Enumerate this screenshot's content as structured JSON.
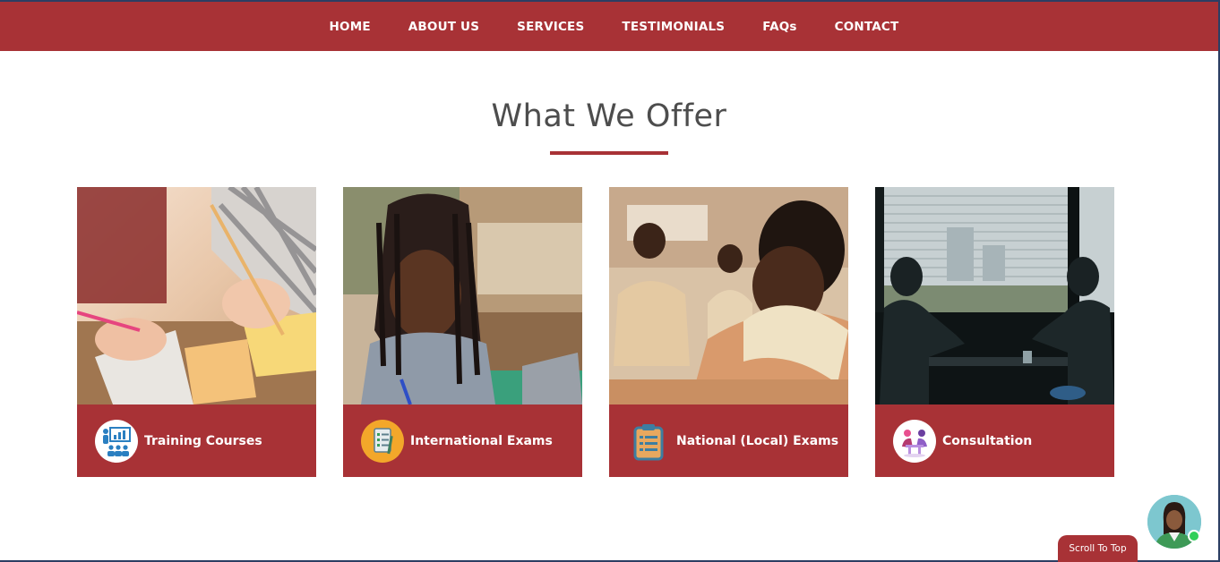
{
  "nav": {
    "items": [
      {
        "label": "HOME"
      },
      {
        "label": "ABOUT US"
      },
      {
        "label": "SERVICES"
      },
      {
        "label": "TESTIMONIALS"
      },
      {
        "label": "FAQs"
      },
      {
        "label": "CONTACT"
      }
    ]
  },
  "section": {
    "title": "What We Offer"
  },
  "cards": [
    {
      "label": "Training Courses",
      "icon": "presentation-class-icon"
    },
    {
      "label": "International Exams",
      "icon": "exam-checklist-icon"
    },
    {
      "label": "National (Local) Exams",
      "icon": "clipboard-icon"
    },
    {
      "label": "Consultation",
      "icon": "consultation-meeting-icon"
    }
  ],
  "scroll_top": {
    "label": "Scroll To Top"
  },
  "colors": {
    "brand": "#a83236",
    "title": "#4d4d4d",
    "frame": "#2c3e63",
    "online": "#2fcf5a"
  }
}
